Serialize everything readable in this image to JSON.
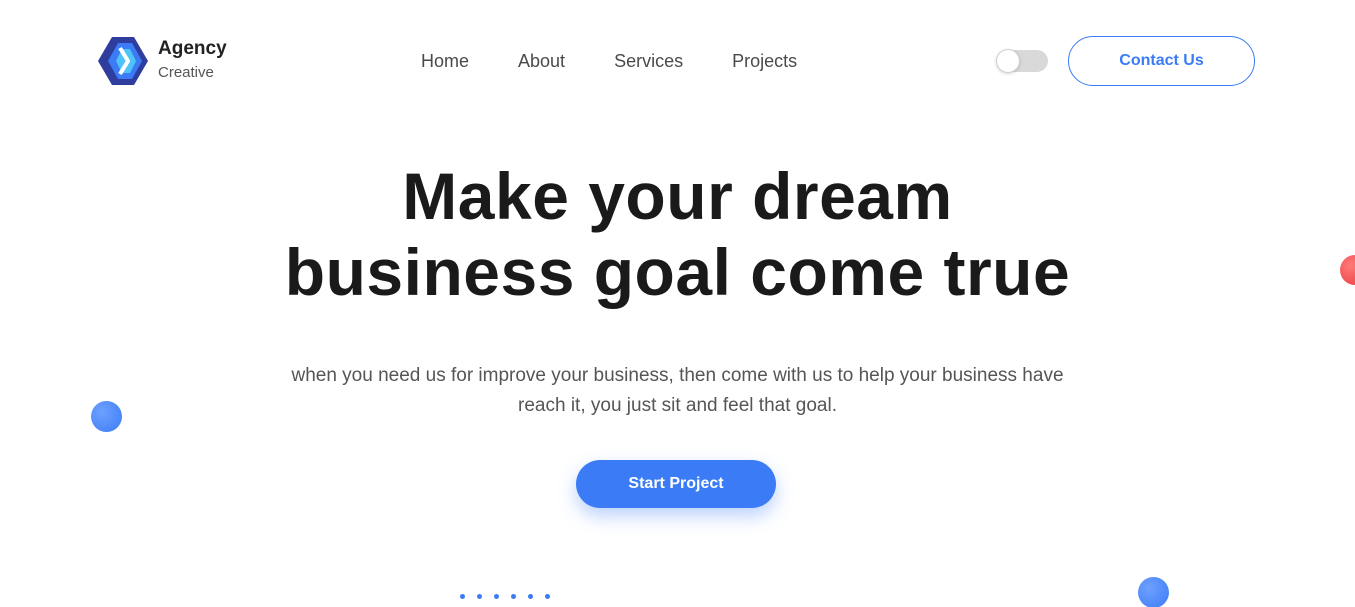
{
  "brand": {
    "name": "Agency",
    "tagline": "Creative",
    "logo_icon": "chevron-hexagon-logo",
    "colors": [
      "#2f3e9e",
      "#3b7cf6",
      "#4fc3f7"
    ]
  },
  "nav": {
    "items": [
      {
        "label": "Home"
      },
      {
        "label": "About"
      },
      {
        "label": "Services"
      },
      {
        "label": "Projects"
      }
    ]
  },
  "header": {
    "theme_toggle_icon": "toggle-switch-icon",
    "theme_toggle_on": false,
    "contact_label": "Contact Us"
  },
  "hero": {
    "title_line1": "Make your dream",
    "title_line2": "business goal come true",
    "description": "when you need us for improve your business, then come with us to help your business have reach it, you just sit and feel that goal.",
    "cta_label": "Start Project"
  },
  "colors": {
    "accent": "#3b7cf6",
    "heading": "#1a1a1a",
    "body_text": "#555555",
    "decor_red": "#e83a3a"
  },
  "decorations": {
    "dot_count": 6
  }
}
